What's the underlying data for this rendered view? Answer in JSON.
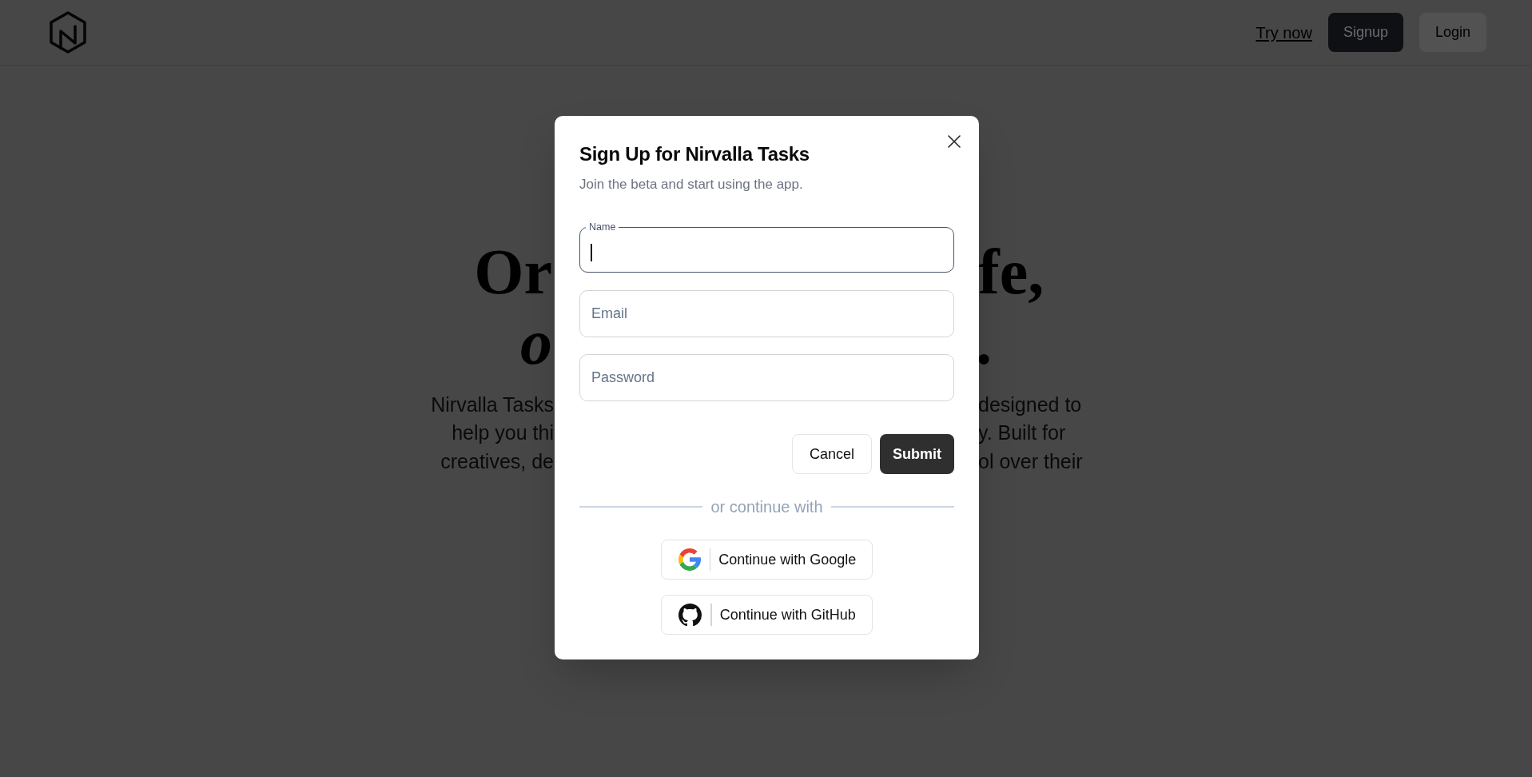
{
  "header": {
    "nav": [
      {
        "kind": "link",
        "label": "Try now"
      },
      {
        "kind": "primary",
        "label": "Signup"
      },
      {
        "kind": "secondary",
        "label": "Login"
      }
    ]
  },
  "hero": {
    "heading_lines": [
      {
        "kind": "upright",
        "left": "Or",
        "right": "fe,"
      },
      {
        "kind": "italic",
        "left": "o",
        "right": "."
      }
    ],
    "paragraph_lines": [
      {
        "left": "Nirvalla Tasks",
        "right": "designed to"
      },
      {
        "left": "help you thi",
        "right": "y. Built for"
      },
      {
        "left": "creatives, de",
        "right": "ol over their"
      }
    ]
  },
  "dialog": {
    "title": "Sign Up for Nirvalla Tasks",
    "subtitle": "Join the beta and start using the app.",
    "fields": [
      {
        "label": "Name",
        "focused": true
      },
      {
        "placeholder": "Email",
        "focused": false
      },
      {
        "placeholder": "Password",
        "focused": false
      }
    ],
    "actions": [
      {
        "kind": "secondary",
        "label": "Cancel"
      },
      {
        "kind": "primary",
        "label": "Submit"
      }
    ],
    "divider": "or continue with",
    "providers": [
      {
        "kind": "google",
        "label": "Continue with Google"
      },
      {
        "kind": "github",
        "label": "Continue with GitHub"
      }
    ]
  }
}
